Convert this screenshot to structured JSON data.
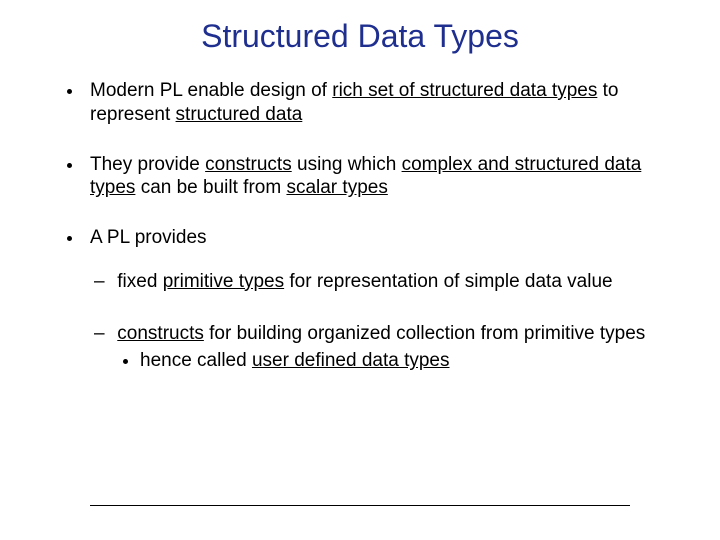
{
  "title": "Structured Data Types",
  "b1": {
    "p1": "Modern PL enable design of ",
    "u1": "rich set of structured data types",
    "p2": " to represent ",
    "u2": "structured data"
  },
  "b2": {
    "p1": "They provide ",
    "u1": "constructs",
    "p2": " using which ",
    "u2": "complex and structured data types",
    "p3": " can be built from ",
    "u3": "scalar types"
  },
  "b3": {
    "p1": "A PL provides"
  },
  "s1": {
    "p1": "fixed ",
    "u1": "primitive types",
    "p2": " for representation of simple data value"
  },
  "s2": {
    "u1": "constructs",
    "p1": " for building organized collection from primitive types"
  },
  "s2a": {
    "p1": "hence called ",
    "u1": "user defined data types"
  }
}
